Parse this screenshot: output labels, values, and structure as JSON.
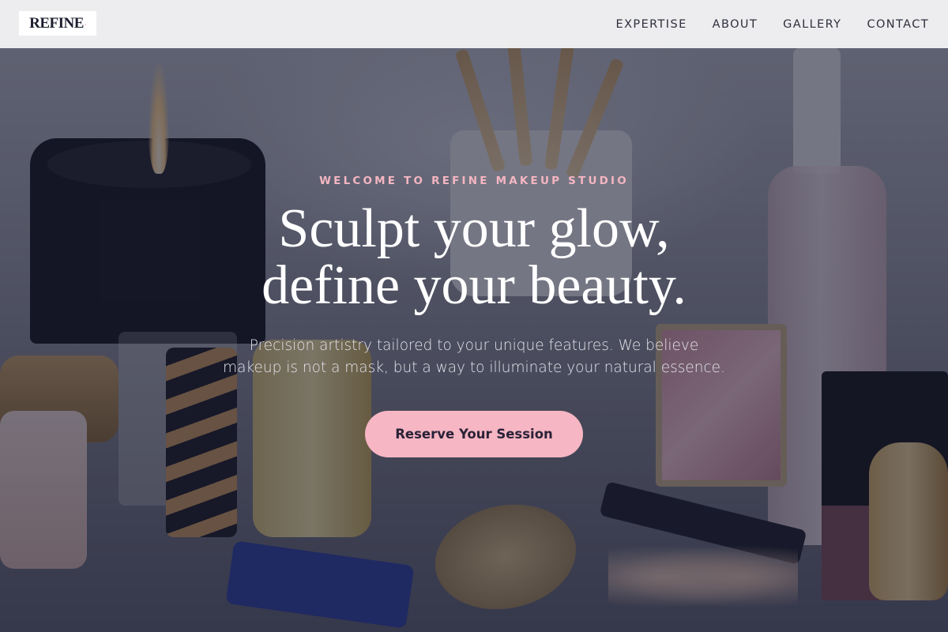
{
  "brand": {
    "logo_text": "REFINE",
    "logo_dot": "."
  },
  "nav": {
    "items": [
      {
        "label": "EXPERTISE"
      },
      {
        "label": "ABOUT"
      },
      {
        "label": "GALLERY"
      },
      {
        "label": "CONTACT"
      }
    ]
  },
  "hero": {
    "eyebrow": "WELCOME TO REFINE MAKEUP STUDIO",
    "headline_line1": "Sculpt your glow,",
    "headline_line2": "define your beauty.",
    "subtext_line1": "Precision artistry tailored to your unique features. We believe",
    "subtext_line2": "makeup is not a mask, but a way to illuminate your natural essence.",
    "cta_label": "Reserve Your Session"
  },
  "colors": {
    "accent_pink": "#f6b6c3",
    "eyebrow_pink": "#f4b6c2",
    "overlay": "#16182e",
    "nav_text": "#2d2f3c"
  }
}
